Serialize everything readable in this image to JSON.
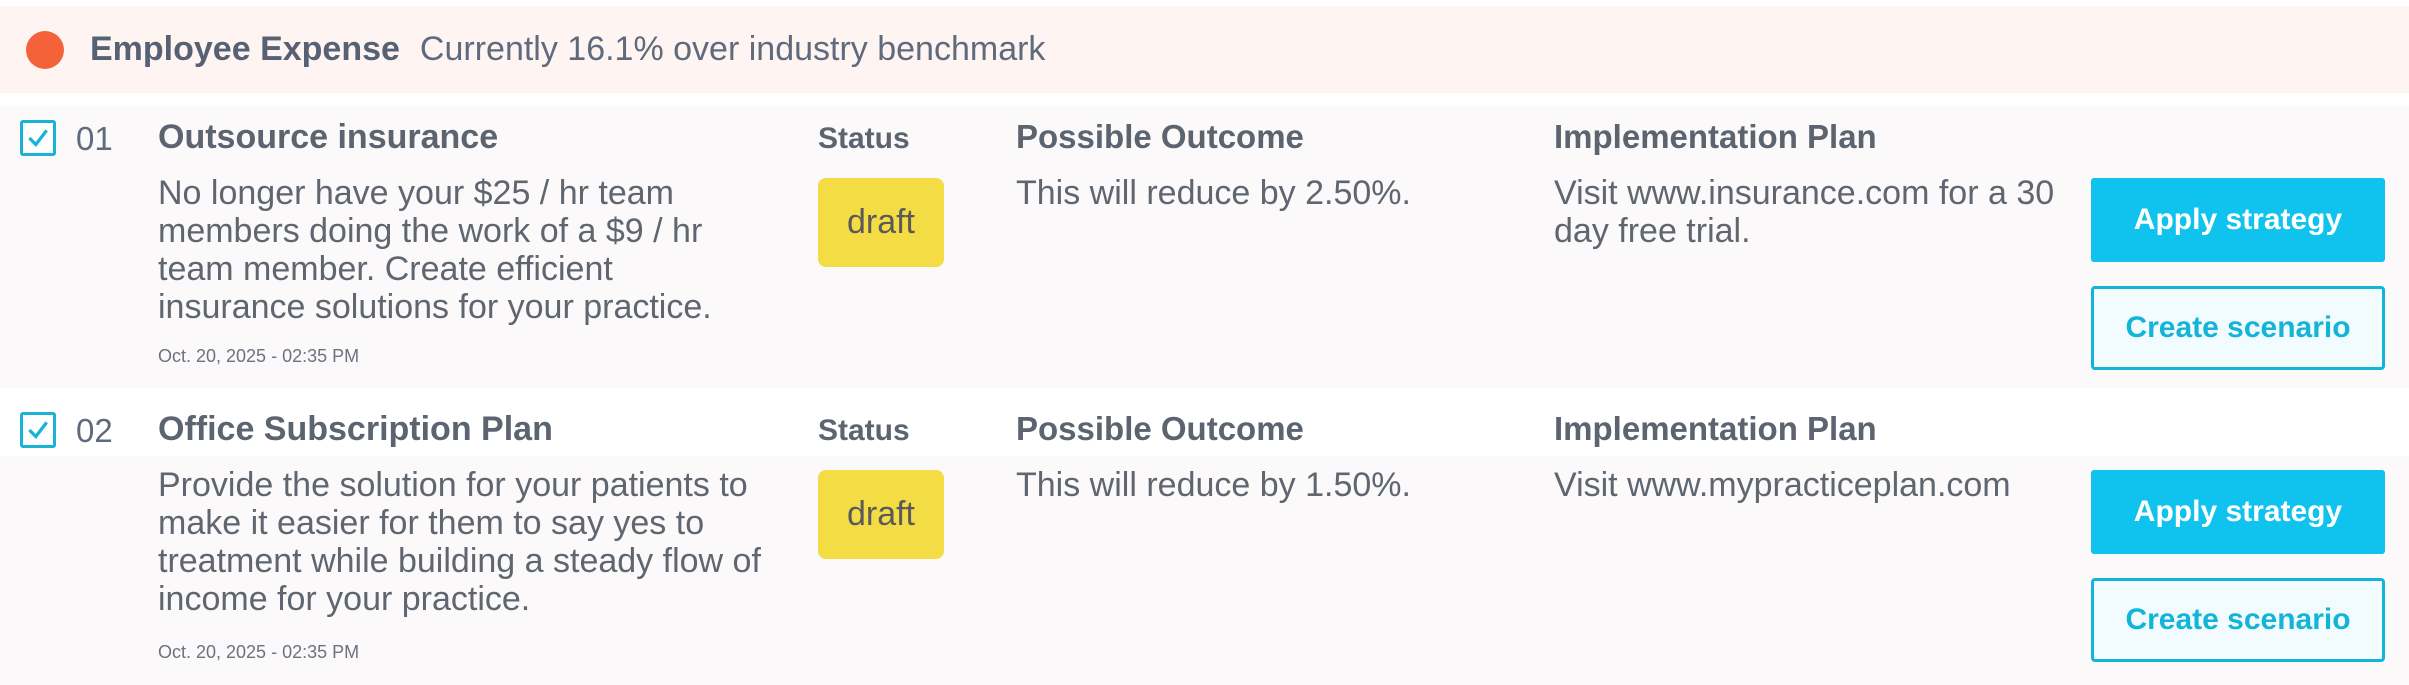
{
  "header": {
    "title": "Employee Expense",
    "subtitle": "Currently 16.1% over industry benchmark",
    "indicator_color": "#f4623a"
  },
  "strategies": [
    {
      "number": "01",
      "checked": true,
      "title": "Outsource insurance",
      "description": "No longer have your $25 / hr team members doing the work of a $9 / hr team member. Create efficient insurance solutions for your practice.",
      "date": "Oct. 20, 2025 - 02:35 PM",
      "status_label": "Status",
      "status": "draft",
      "outcome_label": "Possible Outcome",
      "outcome": "This will reduce by 2.50%.",
      "plan_label": "Implementation Plan",
      "plan": "Visit www.insurance.com for a 30 day free trial.",
      "apply_label": "Apply strategy",
      "scenario_label": "Create scenario"
    },
    {
      "number": "02",
      "checked": true,
      "title": "Office Subscription Plan",
      "description": "Provide the solution for your patients to make it easier for them to say yes to treatment while building a steady flow of income for your practice.",
      "date": "Oct. 20, 2025 - 02:35 PM",
      "status_label": "Status",
      "status": "draft",
      "outcome_label": "Possible Outcome",
      "outcome": "This will reduce by 1.50%.",
      "plan_label": "Implementation Plan",
      "plan": "Visit www.mypracticeplan.com",
      "apply_label": "Apply strategy",
      "scenario_label": "Create scenario"
    }
  ],
  "colors": {
    "accent": "#0fc3ee",
    "draft_badge": "#f4dc45",
    "header_bg": "#fef5f3"
  },
  "icons": {
    "checkbox": "checkbox-checked-icon",
    "indicator": "status-dot-icon"
  }
}
